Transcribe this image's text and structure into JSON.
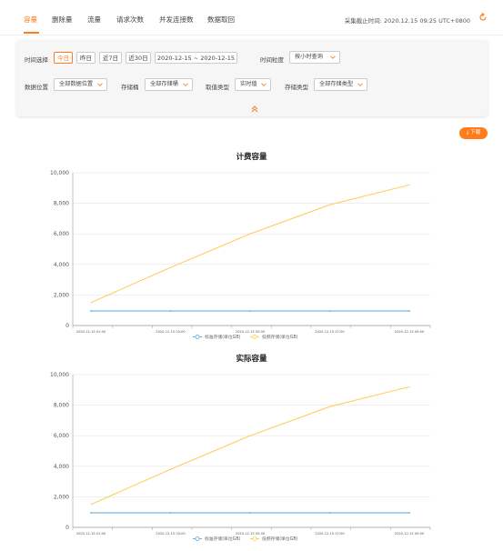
{
  "tabs": [
    {
      "label": "容量",
      "active": true
    },
    {
      "label": "删除量",
      "active": false
    },
    {
      "label": "流量",
      "active": false
    },
    {
      "label": "请求次数",
      "active": false
    },
    {
      "label": "并发连接数",
      "active": false
    },
    {
      "label": "数据取回",
      "active": false
    }
  ],
  "header": {
    "deadline": "采集截止时间: 2020.12.15 09:25 UTC+0800",
    "refresh_icon": "refresh-icon"
  },
  "filters": {
    "time_label": "时间选择",
    "time_buttons": [
      "今日",
      "昨日",
      "近7日",
      "近30日"
    ],
    "date_range": "2020-12-15 ~ 2020-12-15",
    "granularity_label": "时间粒度",
    "granularity_value": "按小时查询",
    "location_label": "数据位置",
    "location_value": "全部数据位置",
    "bucket_label": "存储桶",
    "bucket_value": "全部存储桶",
    "value_type_label": "取值类型",
    "value_type_value": "实时值",
    "storage_type_label": "存储类型",
    "storage_type_value": "全部存储类型"
  },
  "download_label": "下载",
  "colors": {
    "accent": "#ff7d1a",
    "standard": "#5aaae0",
    "low_freq": "#ffc94d"
  },
  "chart_data": [
    {
      "type": "line",
      "title": "计费容量",
      "x": [
        "2020-12-15 01:00",
        "2020-12-15 03:00",
        "2020-12-15 05:00",
        "2020-12-15 07:00",
        "2020-12-15 09:00"
      ],
      "x_tick_labels": [
        "2020-12-15 01:00",
        "2020-12-15 03:00",
        "2020-12-15 05:00",
        "2020-12-15 07:00",
        "2020-12-15 09:00"
      ],
      "y_ticks": [
        "0",
        "2,000",
        "4,000",
        "6,000",
        "8,000",
        "10,000"
      ],
      "ylim": [
        0,
        10000
      ],
      "grid": true,
      "legend_position": "bottom",
      "series": [
        {
          "name": "标准存储(单位GB)",
          "values": [
            950,
            950,
            950,
            950,
            950
          ]
        },
        {
          "name": "低频存储(单位GB)",
          "values": [
            1500,
            3800,
            6000,
            7900,
            9200
          ]
        }
      ]
    },
    {
      "type": "line",
      "title": "实际容量",
      "x": [
        "2020-12-15 01:00",
        "2020-12-15 03:00",
        "2020-12-15 05:00",
        "2020-12-15 07:00",
        "2020-12-15 09:00"
      ],
      "x_tick_labels": [
        "2020-12-15 01:00",
        "2020-12-15 03:00",
        "2020-12-15 05:00",
        "2020-12-15 07:00",
        "2020-12-15 09:00"
      ],
      "y_ticks": [
        "0",
        "2,000",
        "4,000",
        "6,000",
        "8,000",
        "10,000"
      ],
      "ylim": [
        0,
        10000
      ],
      "grid": true,
      "legend_position": "bottom",
      "series": [
        {
          "name": "标准存储(单位GB)",
          "values": [
            950,
            950,
            950,
            950,
            950
          ]
        },
        {
          "name": "低频存储(单位GB)",
          "values": [
            1500,
            3800,
            6000,
            7900,
            9200
          ]
        }
      ]
    }
  ]
}
